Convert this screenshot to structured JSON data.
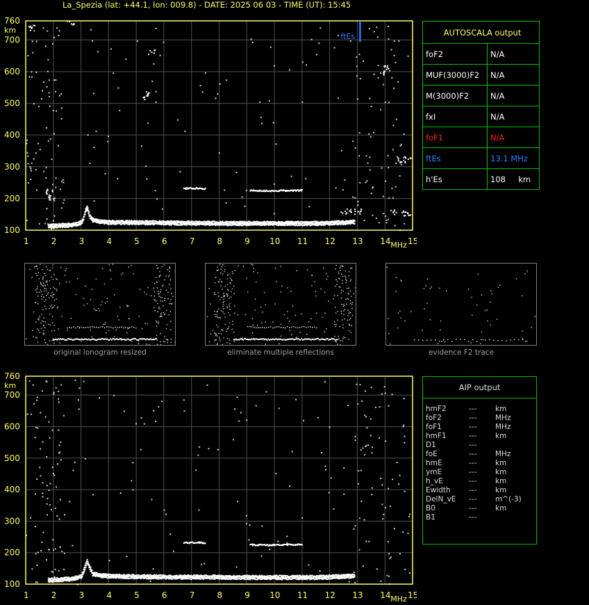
{
  "header": {
    "title": "La_Spezia (lat: +44.1, lon: 009.8) - DATE: 2025 06 03 - TIME (UT): 15:45"
  },
  "axes": {
    "y_unit": "km",
    "x_unit": "MHz",
    "y_ticks": [
      "760",
      "700",
      "600",
      "500",
      "400",
      "300",
      "200",
      "100"
    ],
    "x_ticks": [
      "1",
      "2",
      "3",
      "4",
      "5",
      "6",
      "7",
      "8",
      "9",
      "10",
      "11",
      "12",
      "13",
      "14",
      "15"
    ]
  },
  "colors": {
    "axis": "#ffff66",
    "grid": "#505050",
    "frame": "#00c000",
    "fbEs": "#2a7fff",
    "foF1": "#ff2020"
  },
  "chart_data": [
    {
      "type": "scatter",
      "xlabel": "MHz",
      "ylabel": "km",
      "xlim": [
        1,
        15
      ],
      "ylim": [
        100,
        760
      ],
      "grid": true,
      "series": [
        {
          "values": [
            [
              1.8,
              110
            ],
            [
              2.0,
              111
            ],
            [
              2.2,
              112
            ],
            [
              2.4,
              113
            ],
            [
              2.6,
              114
            ],
            [
              2.8,
              116
            ],
            [
              3.0,
              122
            ],
            [
              3.05,
              130
            ],
            [
              3.1,
              145
            ],
            [
              3.15,
              160
            ],
            [
              3.2,
              170
            ],
            [
              3.3,
              140
            ],
            [
              3.4,
              130
            ],
            [
              3.6,
              126
            ],
            [
              3.8,
              124
            ],
            [
              4.0,
              123
            ],
            [
              4.5,
              122
            ],
            [
              5.0,
              122
            ],
            [
              5.5,
              121
            ],
            [
              6.0,
              121
            ],
            [
              6.5,
              120
            ],
            [
              7.0,
              120
            ],
            [
              7.5,
              120
            ],
            [
              8.0,
              119
            ],
            [
              8.5,
              119
            ],
            [
              9.0,
              119
            ],
            [
              9.5,
              119
            ],
            [
              10.0,
              119
            ],
            [
              10.5,
              119
            ],
            [
              11.0,
              119
            ],
            [
              11.5,
              119
            ],
            [
              12.0,
              120
            ],
            [
              12.5,
              122
            ],
            [
              12.9,
              124
            ]
          ]
        },
        {
          "values": [
            [
              6.7,
              233
            ],
            [
              6.9,
              234
            ],
            [
              7.1,
              234
            ],
            [
              7.3,
              233
            ],
            [
              7.5,
              233
            ],
            [
              9.1,
              227
            ],
            [
              9.4,
              227
            ],
            [
              9.7,
              226
            ],
            [
              10.0,
              226
            ],
            [
              10.3,
              227
            ],
            [
              10.7,
              227
            ],
            [
              11.0,
              228
            ]
          ]
        },
        {
          "values": [
            [
              1.8,
              212
            ],
            [
              1.85,
              225
            ],
            [
              1.9,
              200
            ],
            [
              12.5,
              160
            ],
            [
              12.8,
              160
            ],
            [
              13.0,
              161
            ],
            [
              14.3,
              157
            ],
            [
              14.6,
              155
            ],
            [
              14.9,
              155
            ],
            [
              14.5,
              320
            ],
            [
              14.8,
              325
            ],
            [
              14.0,
              600
            ],
            [
              14.0,
              620
            ],
            [
              5.3,
              520
            ],
            [
              5.45,
              535
            ],
            [
              5.55,
              665
            ],
            [
              1.2,
              740
            ],
            [
              2.6,
              755
            ]
          ]
        }
      ],
      "annotations": [
        "ftEs"
      ]
    },
    {
      "type": "scatter",
      "xlabel": "MHz",
      "ylabel": "km",
      "xlim": [
        1,
        15
      ],
      "ylim": [
        100,
        760
      ],
      "grid": true,
      "series": [
        {
          "values": [
            [
              1.8,
              110
            ],
            [
              2.2,
              112
            ],
            [
              2.6,
              114
            ],
            [
              3.0,
              122
            ],
            [
              3.1,
              145
            ],
            [
              3.2,
              170
            ],
            [
              3.4,
              130
            ],
            [
              3.8,
              124
            ],
            [
              4.5,
              122
            ],
            [
              5.5,
              121
            ],
            [
              6.5,
              120
            ],
            [
              7.5,
              120
            ],
            [
              8.5,
              119
            ],
            [
              9.5,
              119
            ],
            [
              10.5,
              119
            ],
            [
              11.5,
              119
            ],
            [
              12.5,
              122
            ],
            [
              12.9,
              124
            ]
          ]
        },
        {
          "values": [
            [
              6.7,
              233
            ],
            [
              7.1,
              234
            ],
            [
              7.5,
              233
            ],
            [
              9.1,
              227
            ],
            [
              9.7,
              226
            ],
            [
              10.3,
              227
            ],
            [
              11.0,
              228
            ]
          ]
        }
      ]
    }
  ],
  "autoscala": {
    "title": "AUTOSCALA output",
    "rows": [
      {
        "label": "foF2",
        "value": "N/A",
        "unit": ""
      },
      {
        "label": "MUF(3000)F2",
        "value": "N/A",
        "unit": ""
      },
      {
        "label": "M(3000)F2",
        "value": "N/A",
        "unit": ""
      },
      {
        "label": "fxI",
        "value": "N/A",
        "unit": ""
      },
      {
        "label": "foF1",
        "value": "N/A",
        "unit": ""
      },
      {
        "label": "ftEs",
        "value": "13.1 MHz",
        "unit": ""
      },
      {
        "label": "h'Es",
        "value": "108",
        "unit": "km"
      }
    ]
  },
  "thumbs": [
    {
      "caption": "original ionogram resized"
    },
    {
      "caption": "eliminate multiple reflections"
    },
    {
      "caption": "evidence F2 trace"
    }
  ],
  "aip": {
    "title": "AIP output",
    "rows": [
      {
        "label": "hmF2",
        "value": "---",
        "unit": "km"
      },
      {
        "label": "foF2",
        "value": "---",
        "unit": "MHz"
      },
      {
        "label": "foF1",
        "value": "---",
        "unit": "MHz"
      },
      {
        "label": "hmF1",
        "value": "---",
        "unit": "km"
      },
      {
        "label": "D1",
        "value": "---",
        "unit": ""
      },
      {
        "label": "foE",
        "value": "---",
        "unit": "MHz"
      },
      {
        "label": "hmE",
        "value": "---",
        "unit": "km"
      },
      {
        "label": "ymE",
        "value": "---",
        "unit": "km"
      },
      {
        "label": "h_vE",
        "value": "---",
        "unit": "km"
      },
      {
        "label": "Ewidth",
        "value": "---",
        "unit": "km"
      },
      {
        "label": "DelN_vE",
        "value": "---",
        "unit": "m^(-3)"
      },
      {
        "label": "B0",
        "value": "---",
        "unit": "km"
      },
      {
        "label": "B1",
        "value": "---",
        "unit": ""
      }
    ]
  }
}
